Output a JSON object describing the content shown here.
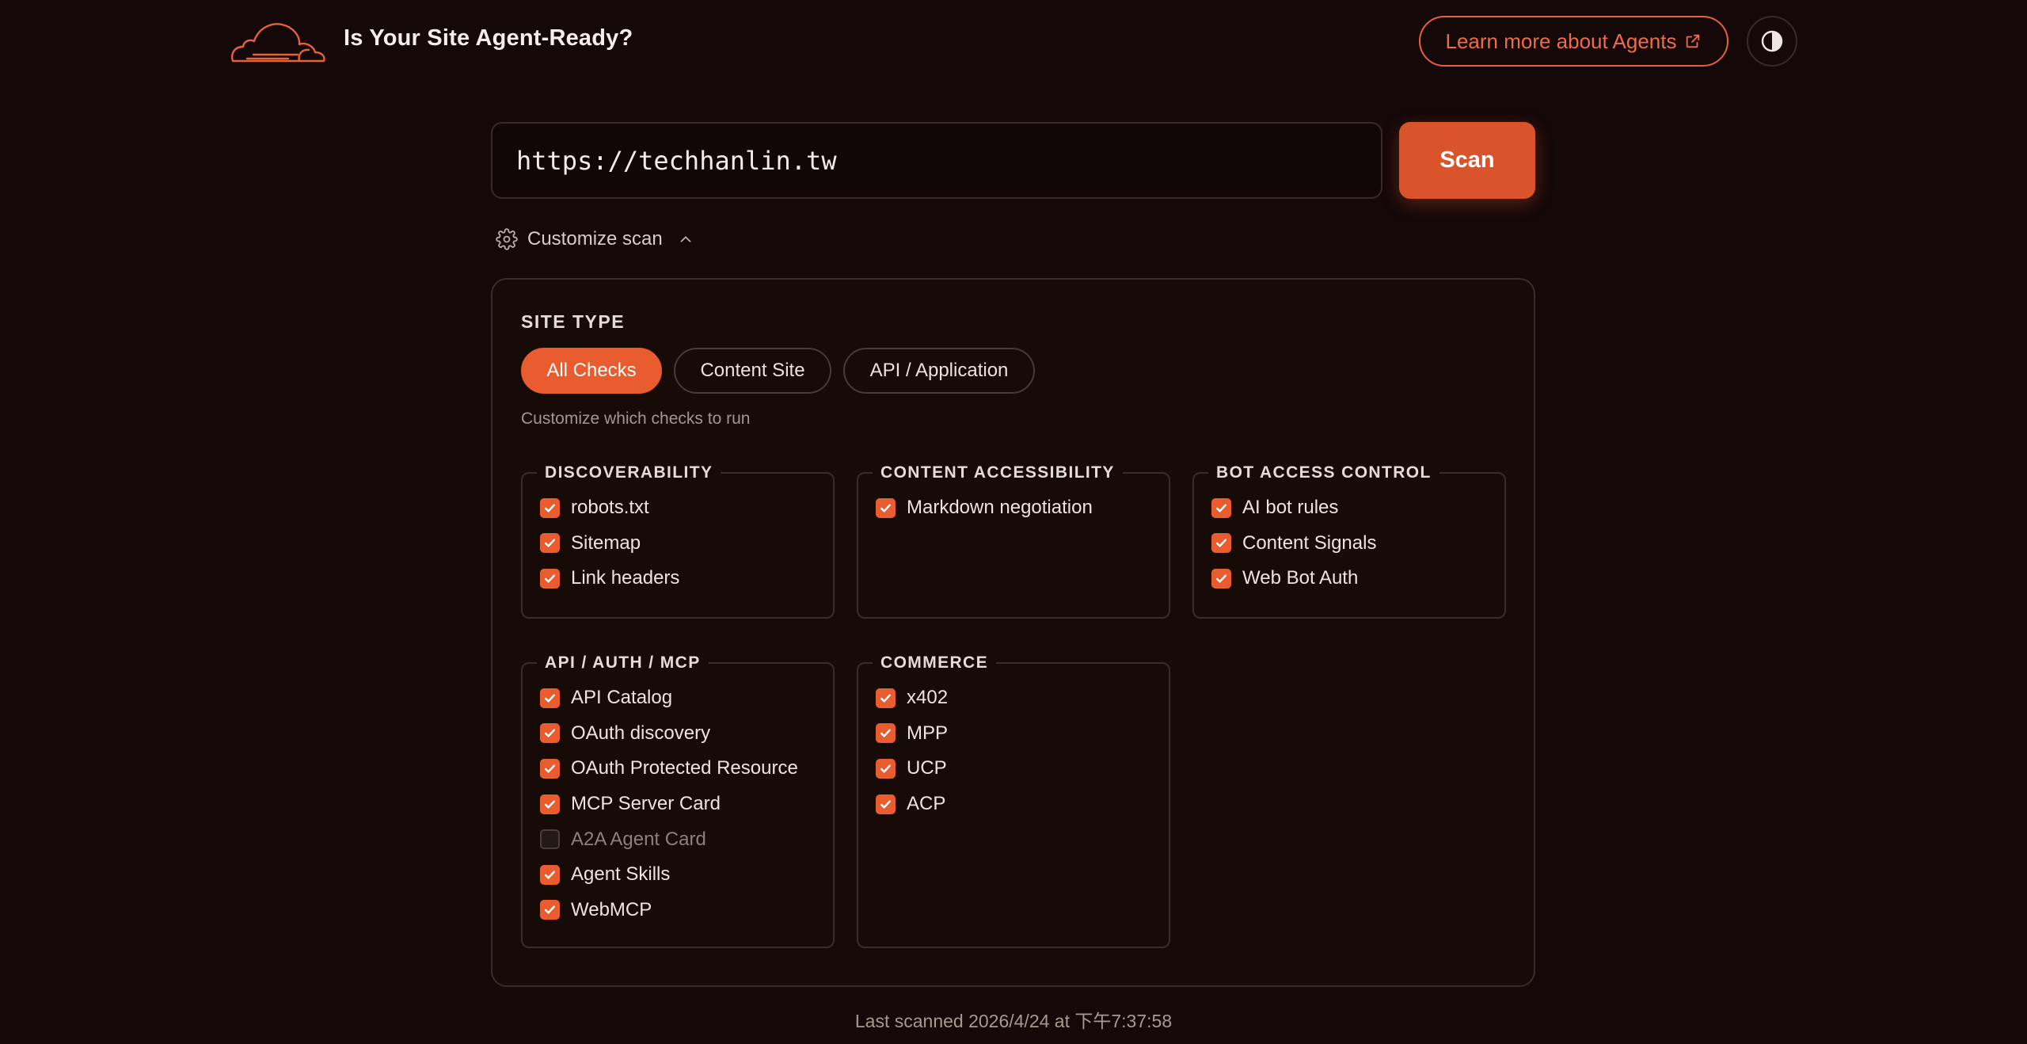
{
  "header": {
    "title": "Is Your Site Agent-Ready?",
    "learn_more_label": "Learn more about Agents",
    "logo_icon": "cloud-logo-icon",
    "theme_toggle_icon": "contrast-icon"
  },
  "scan": {
    "url_value": "https://techhanlin.tw",
    "button_label": "Scan"
  },
  "customize": {
    "label": "Customize scan",
    "expanded": true
  },
  "site_type": {
    "label": "SITE TYPE",
    "options": [
      "All Checks",
      "Content Site",
      "API / Application"
    ],
    "selected": "All Checks",
    "helper": "Customize which checks to run"
  },
  "groups": [
    {
      "title": "DISCOVERABILITY",
      "items": [
        {
          "label": "robots.txt",
          "checked": true
        },
        {
          "label": "Sitemap",
          "checked": true
        },
        {
          "label": "Link headers",
          "checked": true
        }
      ]
    },
    {
      "title": "CONTENT ACCESSIBILITY",
      "items": [
        {
          "label": "Markdown negotiation",
          "checked": true
        }
      ]
    },
    {
      "title": "BOT ACCESS CONTROL",
      "items": [
        {
          "label": "AI bot rules",
          "checked": true
        },
        {
          "label": "Content Signals",
          "checked": true
        },
        {
          "label": "Web Bot Auth",
          "checked": true
        }
      ]
    },
    {
      "title": "API / AUTH / MCP",
      "items": [
        {
          "label": "API Catalog",
          "checked": true
        },
        {
          "label": "OAuth discovery",
          "checked": true
        },
        {
          "label": "OAuth Protected Resource",
          "checked": true
        },
        {
          "label": "MCP Server Card",
          "checked": true
        },
        {
          "label": "A2A Agent Card",
          "checked": false
        },
        {
          "label": "Agent Skills",
          "checked": true
        },
        {
          "label": "WebMCP",
          "checked": true
        }
      ]
    },
    {
      "title": "COMMERCE",
      "items": [
        {
          "label": "x402",
          "checked": true
        },
        {
          "label": "MPP",
          "checked": true
        },
        {
          "label": "UCP",
          "checked": true
        },
        {
          "label": "ACP",
          "checked": true
        }
      ]
    }
  ],
  "footer": {
    "last_scanned": "Last scanned 2026/4/24 at 下午7:37:58"
  },
  "colors": {
    "background": "#140808",
    "accent": "#e85c2f",
    "scan_button": "#d9542a"
  }
}
